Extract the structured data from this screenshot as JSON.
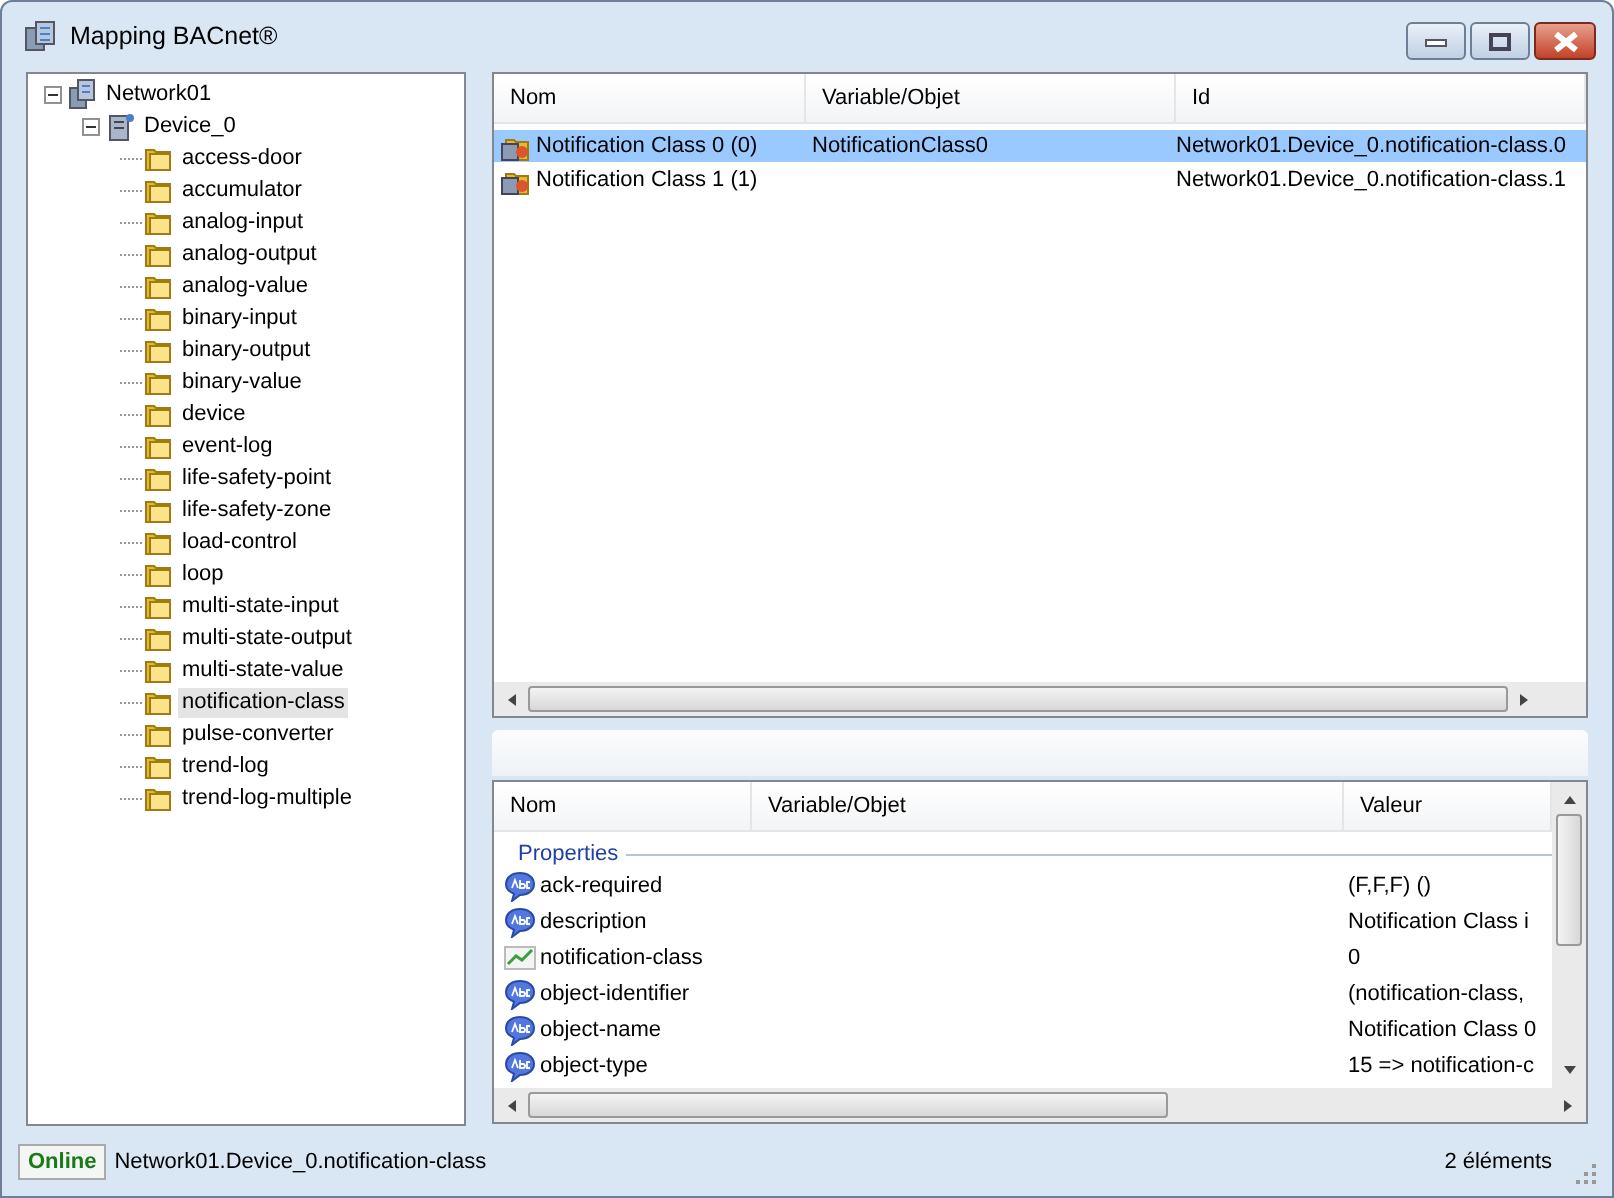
{
  "window": {
    "title": "Mapping BACnet®"
  },
  "tree": [
    {
      "label": "Network01",
      "kind": "network",
      "expanded": true,
      "selected": false,
      "children": [
        {
          "label": "Device_0",
          "kind": "device",
          "expanded": true,
          "selected": false,
          "children": [
            {
              "label": "access-door",
              "kind": "folder",
              "selected": false
            },
            {
              "label": "accumulator",
              "kind": "folder",
              "selected": false
            },
            {
              "label": "analog-input",
              "kind": "folder",
              "selected": false
            },
            {
              "label": "analog-output",
              "kind": "folder",
              "selected": false
            },
            {
              "label": "analog-value",
              "kind": "folder",
              "selected": false
            },
            {
              "label": "binary-input",
              "kind": "folder",
              "selected": false
            },
            {
              "label": "binary-output",
              "kind": "folder",
              "selected": false
            },
            {
              "label": "binary-value",
              "kind": "folder",
              "selected": false
            },
            {
              "label": "device",
              "kind": "folder",
              "selected": false
            },
            {
              "label": "event-log",
              "kind": "folder",
              "selected": false
            },
            {
              "label": "life-safety-point",
              "kind": "folder",
              "selected": false
            },
            {
              "label": "life-safety-zone",
              "kind": "folder",
              "selected": false
            },
            {
              "label": "load-control",
              "kind": "folder",
              "selected": false
            },
            {
              "label": "loop",
              "kind": "folder",
              "selected": false
            },
            {
              "label": "multi-state-input",
              "kind": "folder",
              "selected": false
            },
            {
              "label": "multi-state-output",
              "kind": "folder",
              "selected": false
            },
            {
              "label": "multi-state-value",
              "kind": "folder",
              "selected": false
            },
            {
              "label": "notification-class",
              "kind": "folder",
              "selected": true
            },
            {
              "label": "pulse-converter",
              "kind": "folder",
              "selected": false
            },
            {
              "label": "trend-log",
              "kind": "folder",
              "selected": false
            },
            {
              "label": "trend-log-multiple",
              "kind": "folder",
              "selected": false
            }
          ]
        }
      ]
    }
  ],
  "objects": {
    "columns": [
      "Nom",
      "Variable/Objet",
      "Id"
    ],
    "rows": [
      {
        "name": "Notification Class 0 (0)",
        "variable": "NotificationClass0",
        "id": "Network01.Device_0.notification-class.0",
        "selected": true
      },
      {
        "name": "Notification Class 1 (1)",
        "id": "Network01.Device_0.notification-class.1",
        "selected": false
      }
    ]
  },
  "properties": {
    "columns": [
      "Nom",
      "Variable/Objet",
      "Valeur"
    ],
    "group": "Properties",
    "rows": [
      {
        "name": "ack-required",
        "kind": "text",
        "value": "(F,F,F) ()"
      },
      {
        "name": "description",
        "kind": "text",
        "value": "Notification Class i"
      },
      {
        "name": "notification-class",
        "kind": "numeric",
        "value": "0"
      },
      {
        "name": "object-identifier",
        "kind": "text",
        "value": "(notification-class,"
      },
      {
        "name": "object-name",
        "kind": "text",
        "value": "Notification Class 0"
      },
      {
        "name": "object-type",
        "kind": "text",
        "value": "15 => notification-c"
      }
    ]
  },
  "status_bar": {
    "state": "Online",
    "path": "Network01.Device_0.notification-class",
    "count": "2 éléments"
  }
}
